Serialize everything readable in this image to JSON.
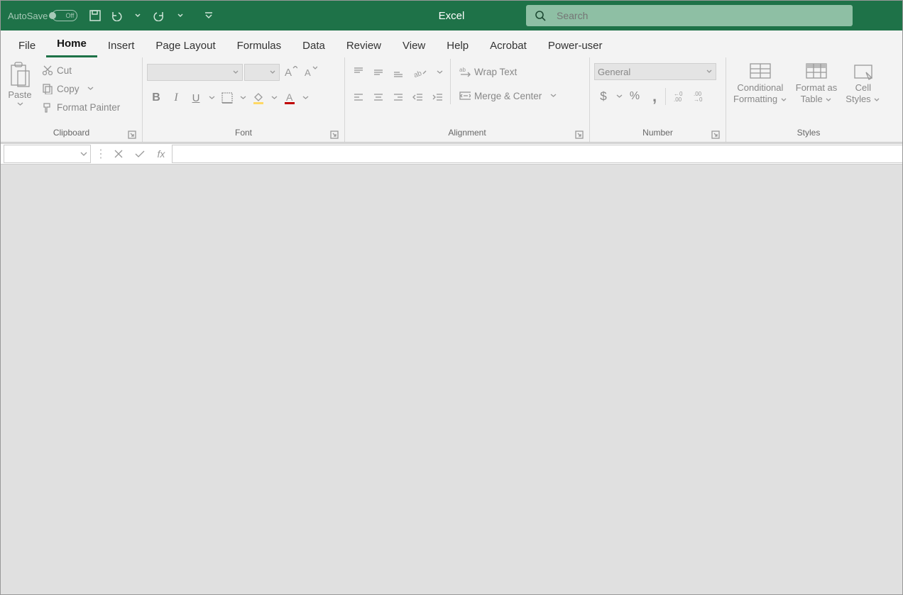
{
  "titleBar": {
    "autosave_label": "AutoSave",
    "autosave_state": "Off",
    "app_title": "Excel",
    "search_placeholder": "Search"
  },
  "tabs": [
    "File",
    "Home",
    "Insert",
    "Page Layout",
    "Formulas",
    "Data",
    "Review",
    "View",
    "Help",
    "Acrobat",
    "Power-user"
  ],
  "activeTab": "Home",
  "ribbon": {
    "clipboard": {
      "label": "Clipboard",
      "paste": "Paste",
      "cut": "Cut",
      "copy": "Copy",
      "format_painter": "Format Painter"
    },
    "font": {
      "label": "Font",
      "font_name": "",
      "font_size": ""
    },
    "alignment": {
      "label": "Alignment",
      "wrap_text": "Wrap Text",
      "merge_center": "Merge & Center"
    },
    "number": {
      "label": "Number",
      "format": "General"
    },
    "styles": {
      "label": "Styles",
      "cond_fmt_l1": "Conditional",
      "cond_fmt_l2": "Formatting",
      "fmt_table_l1": "Format as",
      "fmt_table_l2": "Table",
      "cell_styles_l1": "Cell",
      "cell_styles_l2": "Styles"
    }
  },
  "formulaBar": {
    "name_box": "",
    "formula": ""
  }
}
